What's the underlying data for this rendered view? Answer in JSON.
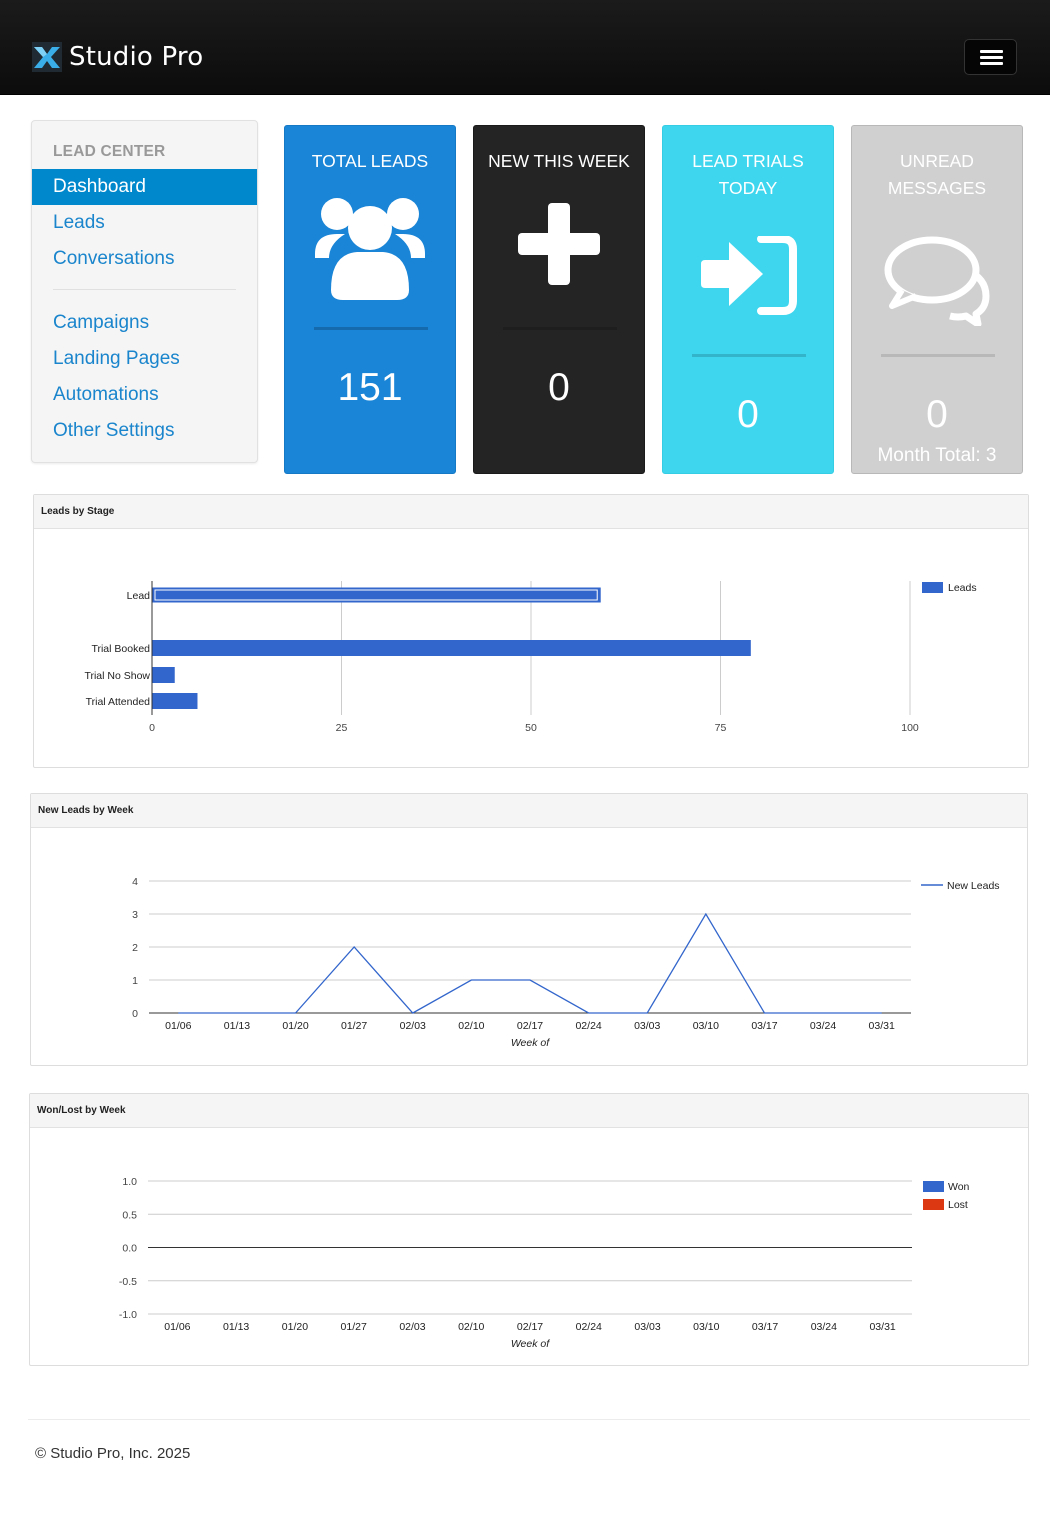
{
  "app": {
    "name": "Studio Pro",
    "icons": {
      "logo": "x-logo-icon",
      "menu": "hamburger-menu-icon"
    }
  },
  "sidebar": {
    "heading": "LEAD CENTER",
    "items": [
      {
        "label": "Dashboard",
        "active": true
      },
      {
        "label": "Leads"
      },
      {
        "label": "Conversations"
      },
      {
        "label": "Campaigns"
      },
      {
        "label": "Landing Pages"
      },
      {
        "label": "Automations"
      },
      {
        "label": "Other Settings"
      }
    ]
  },
  "tiles": {
    "total": {
      "title": "TOTAL LEADS",
      "value": "151",
      "icon": "users-group-icon",
      "color": "#1a85d6"
    },
    "new_week": {
      "title": "NEW THIS WEEK",
      "value": "0",
      "icon": "plus-icon",
      "color": "#242424"
    },
    "trials": {
      "title": "LEAD TRIALS TODAY",
      "value": "0",
      "icon": "sign-in-icon",
      "color": "#3ed6ee"
    },
    "unread": {
      "title": "UNREAD MESSAGES",
      "value": "0",
      "sub": "Month Total: 3",
      "icon": "chat-bubbles-icon",
      "color": "#d0d0d0"
    }
  },
  "panels": {
    "stage_title": "Leads by Stage",
    "week_title": "New Leads by Week",
    "wonlost_title": "Won/Lost by Week"
  },
  "chart_data": [
    {
      "type": "bar",
      "orientation": "horizontal",
      "categories": [
        "Lead",
        "",
        "Trial Booked",
        "Trial No Show",
        "Trial Attended"
      ],
      "series": [
        {
          "name": "Leads",
          "values": [
            59,
            0,
            79,
            3,
            6
          ],
          "color": "#3366cc"
        }
      ],
      "xlim": [
        0,
        100
      ],
      "xticks": [
        "0",
        "25",
        "50",
        "75",
        "100"
      ],
      "legend": "right",
      "grid": true,
      "highlighted_category": "Lead"
    },
    {
      "type": "line",
      "x": [
        "01/06",
        "01/13",
        "01/20",
        "01/27",
        "02/03",
        "02/10",
        "02/17",
        "02/24",
        "03/03",
        "03/10",
        "03/17",
        "03/24",
        "03/31"
      ],
      "series": [
        {
          "name": "New Leads",
          "values": [
            0,
            0,
            0,
            2,
            0,
            1,
            1,
            0,
            0,
            3,
            0,
            0,
            0
          ],
          "color": "#3366cc"
        }
      ],
      "xlabel": "Week of",
      "ylim": [
        0,
        4
      ],
      "yticks": [
        "0",
        "1",
        "2",
        "3",
        "4"
      ],
      "legend": "right",
      "grid": true
    },
    {
      "type": "bar",
      "x": [
        "01/06",
        "01/13",
        "01/20",
        "01/27",
        "02/03",
        "02/10",
        "02/17",
        "02/24",
        "03/03",
        "03/10",
        "03/17",
        "03/24",
        "03/31"
      ],
      "series": [
        {
          "name": "Won",
          "values": [
            0,
            0,
            0,
            0,
            0,
            0,
            0,
            0,
            0,
            0,
            0,
            0,
            0
          ],
          "color": "#3366cc"
        },
        {
          "name": "Lost",
          "values": [
            0,
            0,
            0,
            0,
            0,
            0,
            0,
            0,
            0,
            0,
            0,
            0,
            0
          ],
          "color": "#dc3912"
        }
      ],
      "xlabel": "Week of",
      "ylim": [
        -1.0,
        1.0
      ],
      "yticks": [
        "1.0",
        "0.5",
        "0.0",
        "-0.5",
        "-1.0"
      ],
      "legend": "right",
      "grid": true
    }
  ],
  "footer": {
    "text": "© Studio Pro, Inc. 2025"
  }
}
